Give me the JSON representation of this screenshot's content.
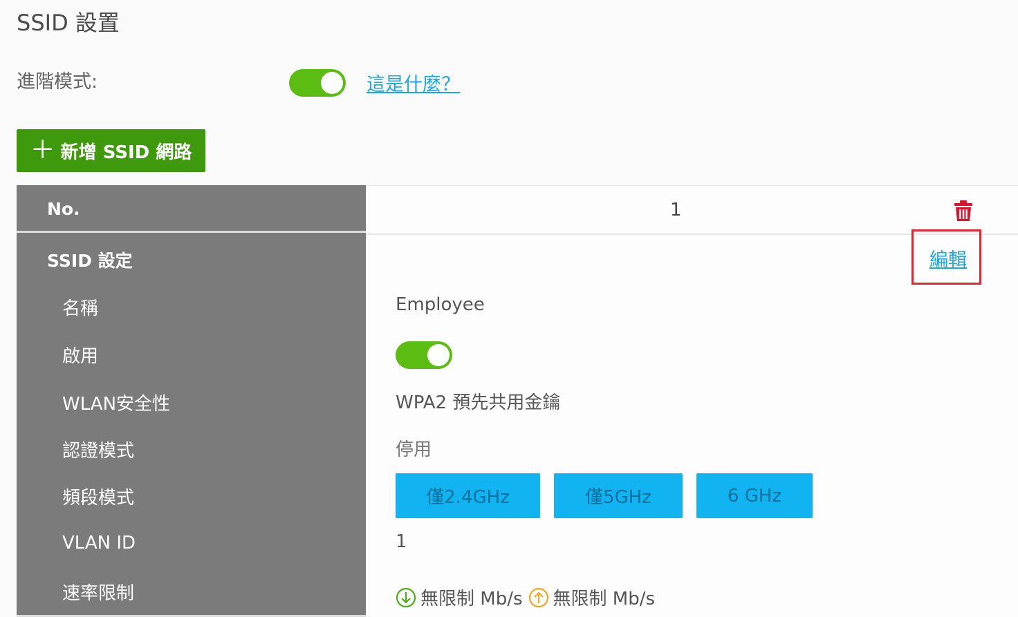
{
  "page": {
    "title": "SSID 設置",
    "advanced_mode_label": "進階模式:",
    "advanced_mode_on": true,
    "help_link": "這是什麼？",
    "add_button_label": "新增 SSID 網路",
    "add_button_icon": "plus-icon"
  },
  "table": {
    "no_header": "No.",
    "no_value": "1",
    "delete_icon": "trash-icon",
    "delete_color": "#e0112b",
    "ssid_section_header": "SSID 設定",
    "edit_link": "編輯",
    "fields": [
      {
        "label": "名稱",
        "value": "Employee"
      },
      {
        "label": "啟用",
        "value_toggle_on": true
      },
      {
        "label": "WLAN安全性",
        "value": "WPA2 預先共用金鑰"
      },
      {
        "label": "認證模式",
        "value": "停用"
      },
      {
        "label": "頻段模式",
        "bands": [
          "僅2.4GHz",
          "僅5GHz",
          "6 GHz"
        ]
      },
      {
        "label": "VLAN ID",
        "value": "1"
      },
      {
        "label": "速率限制",
        "download": "無限制 Mb/s",
        "upload": "無限制 Mb/s"
      }
    ]
  },
  "colors": {
    "toggle_on": "#5bbd12",
    "add_button": "#3e9a0c",
    "band_button": "#12b3f1",
    "link": "#18a8e6",
    "highlight_box": "#e0262e",
    "download_icon": "#4caf1a",
    "upload_icon": "#f5a623"
  }
}
